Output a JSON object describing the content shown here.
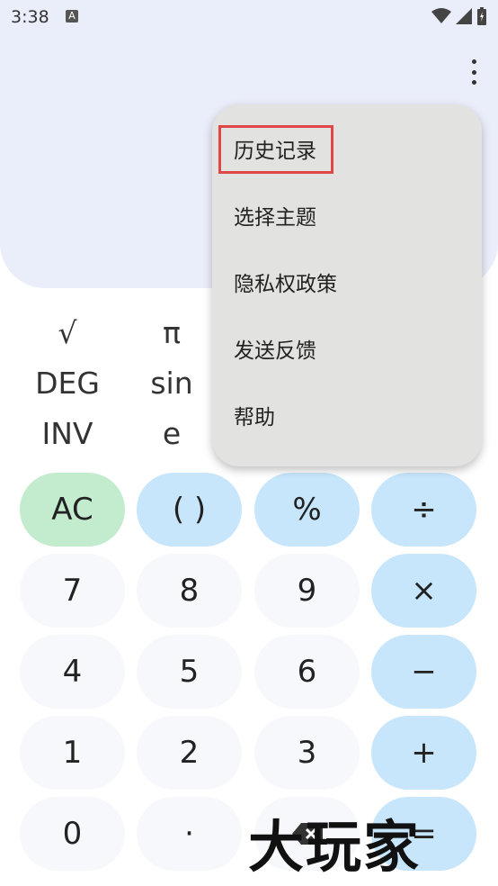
{
  "status": {
    "time": "3:38",
    "a_badge": "A"
  },
  "sci": {
    "row1": [
      "√",
      "π"
    ],
    "row2": [
      "DEG",
      "sin"
    ],
    "row3": [
      "INV",
      "e"
    ]
  },
  "menu": {
    "items": [
      "历史记录",
      "选择主题",
      "隐私权政策",
      "发送反馈",
      "帮助"
    ]
  },
  "keys": {
    "ac": "AC",
    "paren": "( )",
    "percent": "%",
    "divide": "÷",
    "seven": "7",
    "eight": "8",
    "nine": "9",
    "multiply": "×",
    "four": "4",
    "five": "5",
    "six": "6",
    "minus": "−",
    "one": "1",
    "two": "2",
    "three": "3",
    "plus": "+",
    "zero": "0",
    "dot": "·",
    "equals": "="
  },
  "watermark": "大玩家",
  "colors": {
    "display_bg": "#eaedfa",
    "menu_bg": "#e2e3e1",
    "op_key": "#c7e6fb",
    "ac_key": "#c3ecce",
    "highlight": "#e04848"
  }
}
